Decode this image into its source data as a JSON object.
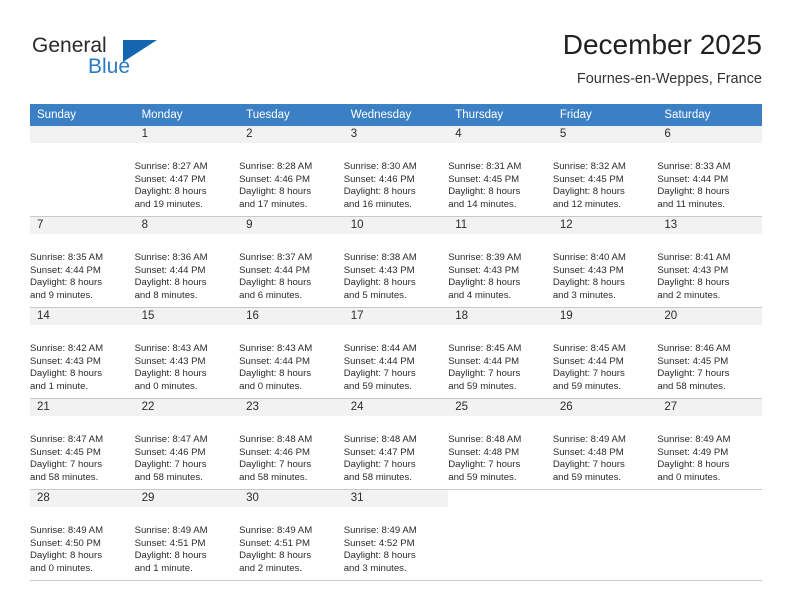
{
  "logo": {
    "word_one": "General",
    "word_two": "Blue",
    "triangle_color": "#1566b0",
    "blue_color": "#2b7cc4"
  },
  "header": {
    "title": "December 2025",
    "subtitle": "Fournes-en-Weppes, France"
  },
  "theme": {
    "header_row_bg": "#3b7fc4",
    "daynum_bg": "#f2f2f2",
    "grid_line": "#c8c8c8",
    "text": "#2b2b2b"
  },
  "weekday_headers": [
    "Sunday",
    "Monday",
    "Tuesday",
    "Wednesday",
    "Thursday",
    "Friday",
    "Saturday"
  ],
  "weeks": [
    [
      {
        "day": "",
        "blank": true,
        "sunrise": "",
        "sunset": "",
        "daylight_1": "",
        "daylight_2": ""
      },
      {
        "day": "1",
        "sunrise": "Sunrise: 8:27 AM",
        "sunset": "Sunset: 4:47 PM",
        "daylight_1": "Daylight: 8 hours",
        "daylight_2": "and 19 minutes."
      },
      {
        "day": "2",
        "sunrise": "Sunrise: 8:28 AM",
        "sunset": "Sunset: 4:46 PM",
        "daylight_1": "Daylight: 8 hours",
        "daylight_2": "and 17 minutes."
      },
      {
        "day": "3",
        "sunrise": "Sunrise: 8:30 AM",
        "sunset": "Sunset: 4:46 PM",
        "daylight_1": "Daylight: 8 hours",
        "daylight_2": "and 16 minutes."
      },
      {
        "day": "4",
        "sunrise": "Sunrise: 8:31 AM",
        "sunset": "Sunset: 4:45 PM",
        "daylight_1": "Daylight: 8 hours",
        "daylight_2": "and 14 minutes."
      },
      {
        "day": "5",
        "sunrise": "Sunrise: 8:32 AM",
        "sunset": "Sunset: 4:45 PM",
        "daylight_1": "Daylight: 8 hours",
        "daylight_2": "and 12 minutes."
      },
      {
        "day": "6",
        "sunrise": "Sunrise: 8:33 AM",
        "sunset": "Sunset: 4:44 PM",
        "daylight_1": "Daylight: 8 hours",
        "daylight_2": "and 11 minutes."
      }
    ],
    [
      {
        "day": "7",
        "sunrise": "Sunrise: 8:35 AM",
        "sunset": "Sunset: 4:44 PM",
        "daylight_1": "Daylight: 8 hours",
        "daylight_2": "and 9 minutes."
      },
      {
        "day": "8",
        "sunrise": "Sunrise: 8:36 AM",
        "sunset": "Sunset: 4:44 PM",
        "daylight_1": "Daylight: 8 hours",
        "daylight_2": "and 8 minutes."
      },
      {
        "day": "9",
        "sunrise": "Sunrise: 8:37 AM",
        "sunset": "Sunset: 4:44 PM",
        "daylight_1": "Daylight: 8 hours",
        "daylight_2": "and 6 minutes."
      },
      {
        "day": "10",
        "sunrise": "Sunrise: 8:38 AM",
        "sunset": "Sunset: 4:43 PM",
        "daylight_1": "Daylight: 8 hours",
        "daylight_2": "and 5 minutes."
      },
      {
        "day": "11",
        "sunrise": "Sunrise: 8:39 AM",
        "sunset": "Sunset: 4:43 PM",
        "daylight_1": "Daylight: 8 hours",
        "daylight_2": "and 4 minutes."
      },
      {
        "day": "12",
        "sunrise": "Sunrise: 8:40 AM",
        "sunset": "Sunset: 4:43 PM",
        "daylight_1": "Daylight: 8 hours",
        "daylight_2": "and 3 minutes."
      },
      {
        "day": "13",
        "sunrise": "Sunrise: 8:41 AM",
        "sunset": "Sunset: 4:43 PM",
        "daylight_1": "Daylight: 8 hours",
        "daylight_2": "and 2 minutes."
      }
    ],
    [
      {
        "day": "14",
        "sunrise": "Sunrise: 8:42 AM",
        "sunset": "Sunset: 4:43 PM",
        "daylight_1": "Daylight: 8 hours",
        "daylight_2": "and 1 minute."
      },
      {
        "day": "15",
        "sunrise": "Sunrise: 8:43 AM",
        "sunset": "Sunset: 4:43 PM",
        "daylight_1": "Daylight: 8 hours",
        "daylight_2": "and 0 minutes."
      },
      {
        "day": "16",
        "sunrise": "Sunrise: 8:43 AM",
        "sunset": "Sunset: 4:44 PM",
        "daylight_1": "Daylight: 8 hours",
        "daylight_2": "and 0 minutes."
      },
      {
        "day": "17",
        "sunrise": "Sunrise: 8:44 AM",
        "sunset": "Sunset: 4:44 PM",
        "daylight_1": "Daylight: 7 hours",
        "daylight_2": "and 59 minutes."
      },
      {
        "day": "18",
        "sunrise": "Sunrise: 8:45 AM",
        "sunset": "Sunset: 4:44 PM",
        "daylight_1": "Daylight: 7 hours",
        "daylight_2": "and 59 minutes."
      },
      {
        "day": "19",
        "sunrise": "Sunrise: 8:45 AM",
        "sunset": "Sunset: 4:44 PM",
        "daylight_1": "Daylight: 7 hours",
        "daylight_2": "and 59 minutes."
      },
      {
        "day": "20",
        "sunrise": "Sunrise: 8:46 AM",
        "sunset": "Sunset: 4:45 PM",
        "daylight_1": "Daylight: 7 hours",
        "daylight_2": "and 58 minutes."
      }
    ],
    [
      {
        "day": "21",
        "sunrise": "Sunrise: 8:47 AM",
        "sunset": "Sunset: 4:45 PM",
        "daylight_1": "Daylight: 7 hours",
        "daylight_2": "and 58 minutes."
      },
      {
        "day": "22",
        "sunrise": "Sunrise: 8:47 AM",
        "sunset": "Sunset: 4:46 PM",
        "daylight_1": "Daylight: 7 hours",
        "daylight_2": "and 58 minutes."
      },
      {
        "day": "23",
        "sunrise": "Sunrise: 8:48 AM",
        "sunset": "Sunset: 4:46 PM",
        "daylight_1": "Daylight: 7 hours",
        "daylight_2": "and 58 minutes."
      },
      {
        "day": "24",
        "sunrise": "Sunrise: 8:48 AM",
        "sunset": "Sunset: 4:47 PM",
        "daylight_1": "Daylight: 7 hours",
        "daylight_2": "and 58 minutes."
      },
      {
        "day": "25",
        "sunrise": "Sunrise: 8:48 AM",
        "sunset": "Sunset: 4:48 PM",
        "daylight_1": "Daylight: 7 hours",
        "daylight_2": "and 59 minutes."
      },
      {
        "day": "26",
        "sunrise": "Sunrise: 8:49 AM",
        "sunset": "Sunset: 4:48 PM",
        "daylight_1": "Daylight: 7 hours",
        "daylight_2": "and 59 minutes."
      },
      {
        "day": "27",
        "sunrise": "Sunrise: 8:49 AM",
        "sunset": "Sunset: 4:49 PM",
        "daylight_1": "Daylight: 8 hours",
        "daylight_2": "and 0 minutes."
      }
    ],
    [
      {
        "day": "28",
        "sunrise": "Sunrise: 8:49 AM",
        "sunset": "Sunset: 4:50 PM",
        "daylight_1": "Daylight: 8 hours",
        "daylight_2": "and 0 minutes."
      },
      {
        "day": "29",
        "sunrise": "Sunrise: 8:49 AM",
        "sunset": "Sunset: 4:51 PM",
        "daylight_1": "Daylight: 8 hours",
        "daylight_2": "and 1 minute."
      },
      {
        "day": "30",
        "sunrise": "Sunrise: 8:49 AM",
        "sunset": "Sunset: 4:51 PM",
        "daylight_1": "Daylight: 8 hours",
        "daylight_2": "and 2 minutes."
      },
      {
        "day": "31",
        "sunrise": "Sunrise: 8:49 AM",
        "sunset": "Sunset: 4:52 PM",
        "daylight_1": "Daylight: 8 hours",
        "daylight_2": "and 3 minutes."
      },
      {
        "day": "",
        "blank": true,
        "empty": true,
        "sunrise": "",
        "sunset": "",
        "daylight_1": "",
        "daylight_2": ""
      },
      {
        "day": "",
        "blank": true,
        "empty": true,
        "sunrise": "",
        "sunset": "",
        "daylight_1": "",
        "daylight_2": ""
      },
      {
        "day": "",
        "blank": true,
        "empty": true,
        "sunrise": "",
        "sunset": "",
        "daylight_1": "",
        "daylight_2": ""
      }
    ]
  ]
}
